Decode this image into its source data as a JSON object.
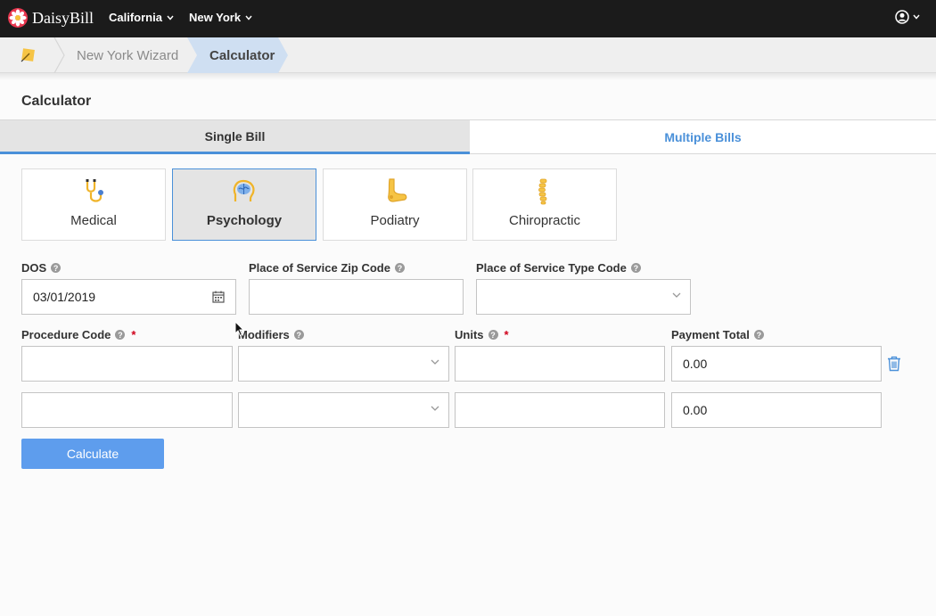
{
  "app": {
    "brand": "DaisyBill"
  },
  "topnav": {
    "state1": "California",
    "state2": "New York"
  },
  "breadcrumb": {
    "item1": "New York Wizard",
    "item2": "Calculator"
  },
  "page": {
    "title": "Calculator"
  },
  "tabs": {
    "single": "Single Bill",
    "multiple": "Multiple Bills"
  },
  "specialties": [
    {
      "label": "Medical",
      "icon": "stethoscope-icon",
      "selected": false
    },
    {
      "label": "Psychology",
      "icon": "brain-icon",
      "selected": true
    },
    {
      "label": "Podiatry",
      "icon": "foot-icon",
      "selected": false
    },
    {
      "label": "Chiropractic",
      "icon": "spine-icon",
      "selected": false
    }
  ],
  "form": {
    "dos_label": "DOS",
    "dos_value": "03/01/2019",
    "zip_label": "Place of Service Zip Code",
    "zip_value": "",
    "type_label": "Place of Service Type Code",
    "type_value": "",
    "procedure_label": "Procedure Code",
    "modifiers_label": "Modifiers",
    "units_label": "Units",
    "payment_label": "Payment Total",
    "required_mark": "*",
    "help_mark": "?",
    "rows": [
      {
        "procedure": "",
        "modifiers": "",
        "units": "",
        "payment": "0.00"
      },
      {
        "procedure": "",
        "modifiers": "",
        "units": "",
        "payment": "0.00"
      }
    ]
  },
  "buttons": {
    "calculate": "Calculate"
  },
  "colors": {
    "accent": "#4a90d9",
    "button": "#5e9ded",
    "topbar": "#1b1b1b"
  }
}
